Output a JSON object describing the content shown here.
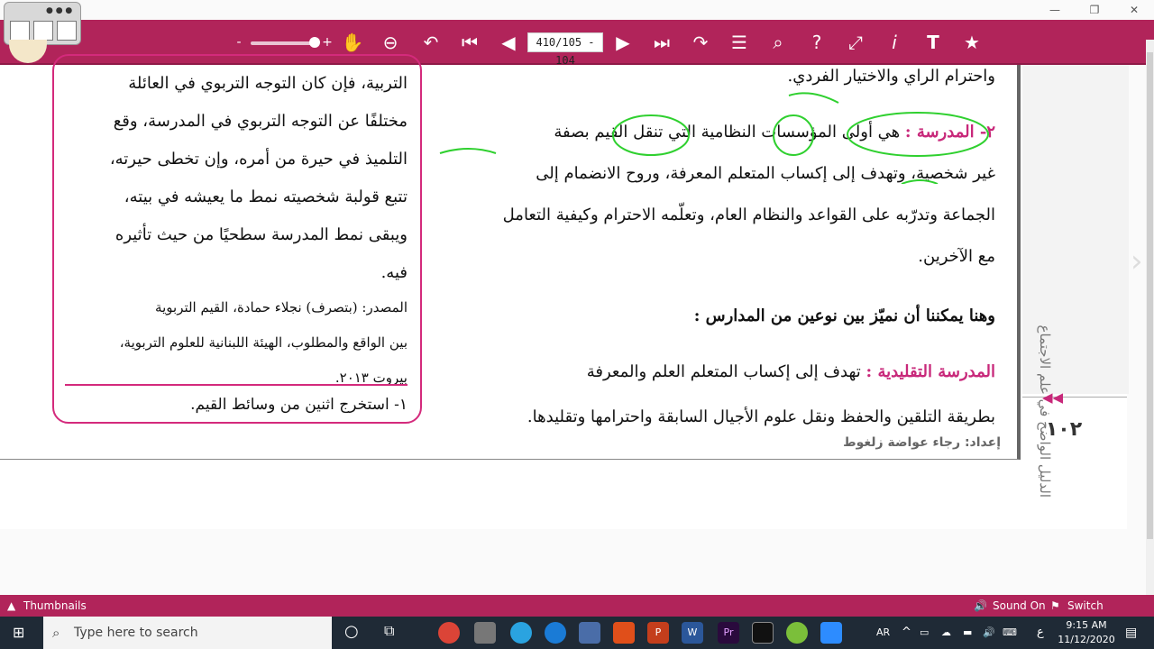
{
  "toolbar": {
    "zoom_minus": "-",
    "zoom_plus": "+",
    "page_indicator": "410/105 - 104",
    "icons": [
      "hand-icon",
      "zoom-out-icon",
      "undo-icon",
      "first-page-icon",
      "prev-page-icon",
      "next-page-icon",
      "last-page-icon",
      "redo-icon",
      "list-icon",
      "search-icon",
      "help-icon",
      "fullscreen-icon",
      "info-icon",
      "text-icon",
      "bookmark-icon"
    ]
  },
  "document": {
    "side_box": {
      "lines": [
        "التربية، فإن كان التوجه التربوي في العائلة",
        "مختلفًا عن التوجه التربوي في المدرسة، وقع",
        "التلميذ في حيرة من أمره، وإن تخطى حيرته،",
        "تتبع قولبة شخصيته نمط ما يعيشه في بيته،",
        "ويبقى نمط المدرسة سطحيًا من حيث تأثيره",
        "فيه."
      ],
      "source_lines": [
        "المصدر: (بتصرف) نجلاء حمادة، القيم التربوية",
        "بين الواقع والمطلوب، الهيئة اللبنانية للعلوم التربوية،",
        "بيروت ٢٠١٣."
      ],
      "question": "١- استخرج اثنين من وسائط القيم."
    },
    "main": {
      "line0": "واحترام الراي والاختيار الفردي.",
      "heading2": "٢- المدرسة :",
      "line1_rest": "هي أولى المؤسسات النظامية التي تنقل القيم بصفة",
      "line2": "غير شخصية، وتهدف إلى إكساب المتعلم المعرفة، وروح الانضمام إلى",
      "line3": "الجماعة وتدرّبه على القواعد والنظام العام، وتعلّمه الاحترام وكيفية التعامل",
      "line4": "مع الآخرين.",
      "subheading": "وهنا يمكننا أن نميّز بين نوعين من المدارس :",
      "trad_heading": "المدرسة التقليدية :",
      "trad_rest": "تهدف إلى إكساب المتعلم العلم والمعرفة",
      "trad_line2": "بطريقة التلقين والحفظ ونقل علوم الأجيال السابقة واحترامها وتقليدها."
    },
    "vertical_title": "الدليل الواضح في علم الاجتماع",
    "page_number": "١٠٢",
    "credit": "إعداد: رجاء عواضة زلغوط"
  },
  "bottombar": {
    "thumbnails": "Thumbnails",
    "sound": "Sound On",
    "switch_language": "Switch Language"
  },
  "taskbar": {
    "search_placeholder": "Type here to search",
    "lang": "AR",
    "time": "9:15 AM",
    "date": "11/12/2020",
    "input_indicator": "ع"
  }
}
